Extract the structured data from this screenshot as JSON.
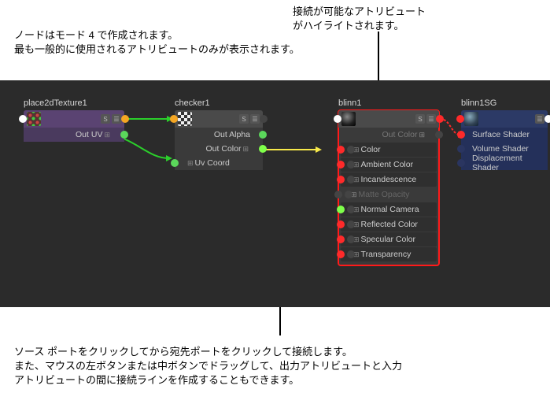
{
  "annotations": {
    "top_left_1": "ノードはモード 4 で作成されます。",
    "top_left_2": "最も一般的に使用されるアトリビュートのみが表示されます。",
    "top_right_1": "接続が可能なアトリビュート",
    "top_right_2": "がハイライトされます。",
    "bottom_1": "ソース ポートをクリックしてから宛先ポートをクリックして接続します。",
    "bottom_2": "また、マウスの左ボタンまたは中ボタンでドラッグして、出力アトリビュートと入力",
    "bottom_3": "アトリビュートの間に接続ラインを作成することもできます。"
  },
  "nodes": {
    "place2d": {
      "title": "place2dTexture1",
      "attrs": {
        "out_uv": "Out UV"
      },
      "chips": [
        "S",
        "☰"
      ]
    },
    "checker": {
      "title": "checker1",
      "attrs": {
        "out_alpha": "Out Alpha",
        "out_color": "Out Color",
        "uv_coord": "Uv Coord"
      },
      "chips": [
        "S",
        "☰"
      ]
    },
    "blinn": {
      "title": "blinn1",
      "attrs": {
        "out_color": "Out Color",
        "color": "Color",
        "ambient": "Ambient Color",
        "incand": "Incandescence",
        "matte": "Matte Opacity",
        "normal": "Normal Camera",
        "reflected": "Reflected Color",
        "specular": "Specular Color",
        "transparency": "Transparency"
      },
      "chips": [
        "S",
        "☰"
      ]
    },
    "blinnsg": {
      "title": "blinn1SG",
      "attrs": {
        "surface": "Surface Shader",
        "volume": "Volume Shader",
        "displacement": "Displacement Shader"
      },
      "chips": [
        "☰"
      ]
    }
  },
  "colors": {
    "canvas": "#2b2b2b",
    "highlight": "#ff1a1a",
    "wire_green": "#2bcf2b",
    "wire_yellow": "#f7e94a"
  }
}
